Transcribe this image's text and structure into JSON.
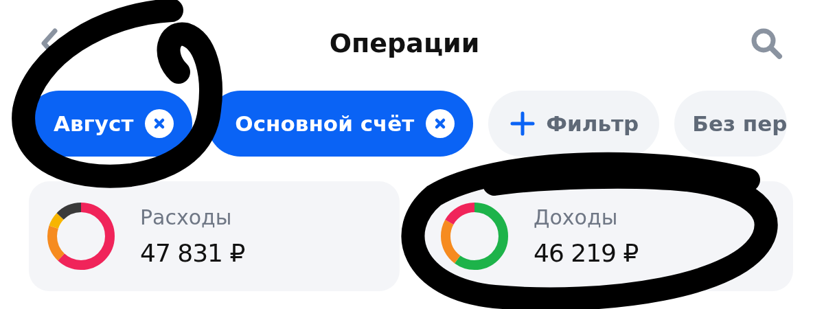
{
  "header": {
    "title": "Операции"
  },
  "chips": [
    {
      "kind": "filter",
      "label": "Август",
      "selected": true
    },
    {
      "kind": "filter",
      "label": "Основной счёт",
      "selected": true
    },
    {
      "kind": "add",
      "label": "Фильтр",
      "selected": false
    },
    {
      "kind": "plain",
      "label": "Без пер",
      "selected": false
    }
  ],
  "summary": [
    {
      "kind": "expense",
      "label": "Расходы",
      "amount": "47 831 ₽"
    },
    {
      "kind": "income",
      "label": "Доходы",
      "amount": "46 219 ₽"
    }
  ],
  "annotations": [
    {
      "kind": "scribble"
    },
    {
      "kind": "scribble"
    }
  ]
}
